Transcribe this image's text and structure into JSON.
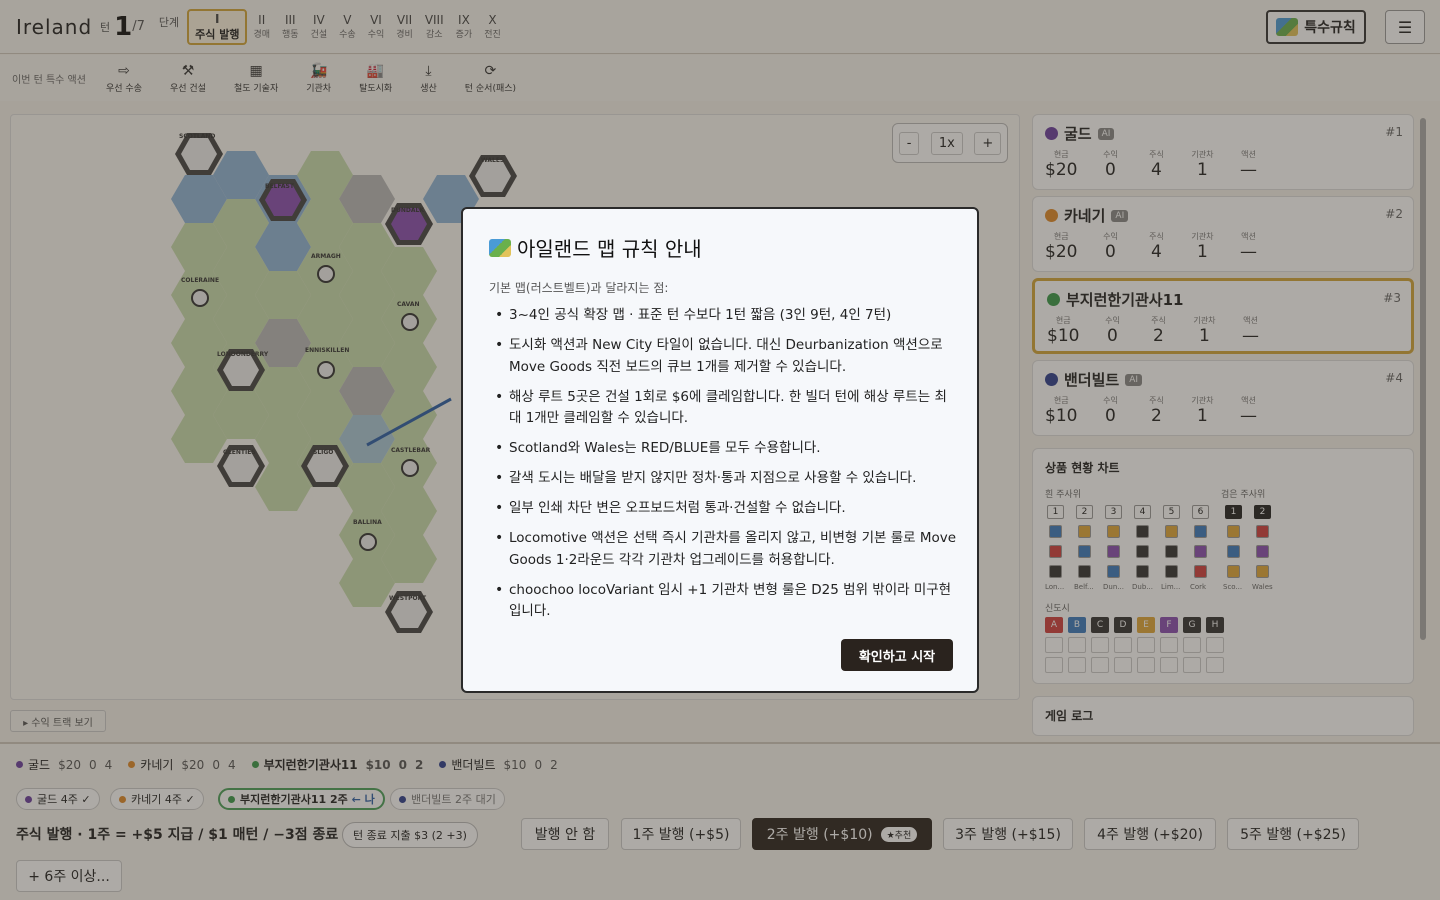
{
  "topbar": {
    "title": "Ireland",
    "turn_label": "턴",
    "turn_current": "1",
    "turn_max": "/7",
    "stage_label": "단계",
    "phases": [
      {
        "roman": "I",
        "label": "주식 발행"
      },
      {
        "roman": "II",
        "label": "경매"
      },
      {
        "roman": "III",
        "label": "행동"
      },
      {
        "roman": "IV",
        "label": "건설"
      },
      {
        "roman": "V",
        "label": "수송"
      },
      {
        "roman": "VI",
        "label": "수익"
      },
      {
        "roman": "VII",
        "label": "경비"
      },
      {
        "roman": "VIII",
        "label": "감소"
      },
      {
        "roman": "IX",
        "label": "증가"
      },
      {
        "roman": "X",
        "label": "전진"
      }
    ],
    "special_rules_label": "특수규칙",
    "menu_icon": "☰"
  },
  "actionbar": {
    "label": "이번 턴 특수 액션",
    "actions": [
      {
        "icon": "⇨",
        "label": "우선 수송"
      },
      {
        "icon": "⚒",
        "label": "우선 건설"
      },
      {
        "icon": "▦",
        "label": "철도 기술자"
      },
      {
        "icon": "🚂",
        "label": "기관차"
      },
      {
        "icon": "🏭",
        "label": "탈도시화"
      },
      {
        "icon": "⤓",
        "label": "생산"
      },
      {
        "icon": "⟳",
        "label": "턴 순서(패스)"
      }
    ]
  },
  "board": {
    "zoom": {
      "minus": "-",
      "level": "1x",
      "plus": "+"
    },
    "cities": [
      "SCOTLAND",
      "BELFAST",
      "DUNDALK",
      "WALES",
      "LONDONDERRY",
      "GLENTIES",
      "SLIGO",
      "WESTPORT"
    ],
    "towns": [
      "ARMAGH",
      "COLERAINE",
      "CAVAN",
      "ENNISKILLEN",
      "CASTLEBAR",
      "BALLINA"
    ],
    "track_button": "▸ 수익 트랙 보기"
  },
  "players": [
    {
      "name": "굴드",
      "ai": "AI",
      "rank": "#1",
      "color": "#6b3fa0",
      "cash": "$20",
      "income": "0",
      "shares": "4",
      "loco": "1",
      "action": "—"
    },
    {
      "name": "카네기",
      "ai": "AI",
      "rank": "#2",
      "color": "#e08a2a",
      "cash": "$20",
      "income": "0",
      "shares": "4",
      "loco": "1",
      "action": "—"
    },
    {
      "name": "부지런한기관사11",
      "ai": "",
      "rank": "#3",
      "color": "#3a9a4a",
      "cash": "$10",
      "income": "0",
      "shares": "2",
      "loco": "1",
      "action": "—"
    },
    {
      "name": "밴더빌트",
      "ai": "AI",
      "rank": "#4",
      "color": "#2e3f8f",
      "cash": "$10",
      "income": "0",
      "shares": "2",
      "loco": "1",
      "action": "—"
    }
  ],
  "stat_labels": {
    "cash": "현금",
    "income": "수익",
    "shares": "주식",
    "loco": "기관차",
    "action": "액션"
  },
  "goods": {
    "title": "상품 현황 차트",
    "white_label": "흰 주사위",
    "black_label": "검은 주사위",
    "white_nums": [
      "1",
      "2",
      "3",
      "4",
      "5",
      "6"
    ],
    "black_nums": [
      "1",
      "2"
    ],
    "white_names": [
      "Lon...",
      "Belf...",
      "Dun...",
      "Dub...",
      "Lim...",
      "Cork"
    ],
    "black_names": [
      "Sco...",
      "Wales"
    ],
    "newcity_label": "신도시",
    "newcities": [
      "A",
      "B",
      "C",
      "D",
      "E",
      "F",
      "G",
      "H"
    ]
  },
  "log_title": "게임 로그",
  "bottom": {
    "players_line": [
      {
        "name": "굴드",
        "color": "#6b3fa0",
        "cash": "$20",
        "income": "0",
        "shares": "4"
      },
      {
        "name": "카네기",
        "color": "#e08a2a",
        "cash": "$20",
        "income": "0",
        "shares": "4"
      },
      {
        "name": "부지런한기관사11",
        "color": "#3a9a4a",
        "cash": "$10",
        "income": "0",
        "shares": "2"
      },
      {
        "name": "밴더빌트",
        "color": "#2e3f8f",
        "cash": "$10",
        "income": "0",
        "shares": "2"
      }
    ],
    "pills": [
      {
        "text": "굴드 4주",
        "suffix": "✓",
        "color": "#6b3fa0"
      },
      {
        "text": "카네기 4주",
        "suffix": "✓",
        "color": "#e08a2a"
      },
      {
        "text": "부지런한기관사11 2주",
        "suffix": "← 나",
        "color": "#3a9a4a"
      },
      {
        "text": "밴더빌트 2주",
        "suffix": "대기",
        "color": "#2e3f8f"
      }
    ],
    "issue_label": "주식 발행 · 1주 = +$5 지급 / $1 매턴 / −3점 종료",
    "cost_label": "턴 종료 지출 $3 (",
    "cost_tail": "2 + ",
    "cost_end": "3)",
    "options": [
      "발행 안 함",
      "1주 발행 (+$5)",
      "2주 발행 (+$10)",
      "3주 발행 (+$15)",
      "4주 발행 (+$20)",
      "5주 발행 (+$25)"
    ],
    "recommended": "★추천",
    "more": "+ 6주 이상..."
  },
  "modal": {
    "title": "아일랜드 맵 규칙 안내",
    "subtitle": "기본 맵(러스트벨트)과 달라지는 점:",
    "items": [
      "3~4인 공식 확장 맵 · 표준 턴 수보다 1턴 짧음 (3인 9턴, 4인 7턴)",
      "도시화 액션과 New City 타일이 없습니다. 대신 Deurbanization 액션으로 Move Goods 직전 보드의 큐브 1개를 제거할 수 있습니다.",
      "해상 루트 5곳은 건설 1회로 $6에 클레임합니다. 한 빌더 턴에 해상 루트는 최대 1개만 클레임할 수 있습니다.",
      "Scotland와 Wales는 RED/BLUE를 모두 수용합니다.",
      "갈색 도시는 배달을 받지 않지만 정차·통과 지점으로 사용할 수 있습니다.",
      "일부 인쇄 차단 변은 오프보드처럼 통과·건설할 수 없습니다.",
      "Locomotive 액션은 선택 즉시 기관차를 올리지 않고, 비변형 기본 룰로 Move Goods 1·2라운드 각각 기관차 업그레이드를 허용합니다.",
      "choochoo locoVariant 임시 +1 기관차 변형 룰은 D25 범위 밖이라 미구현입니다."
    ],
    "confirm": "확인하고 시작"
  }
}
